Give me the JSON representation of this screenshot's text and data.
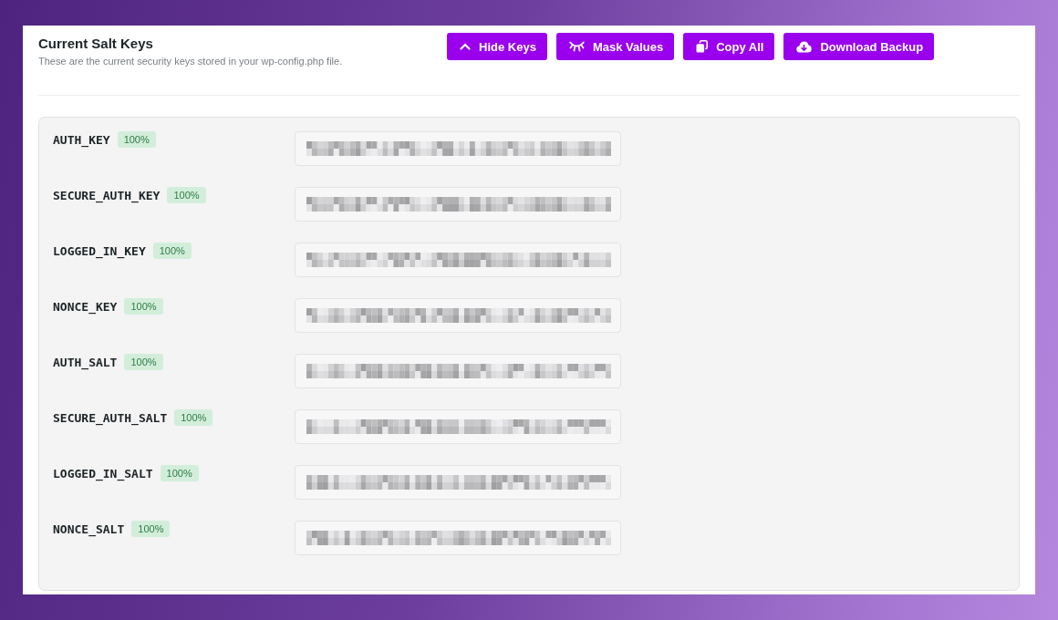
{
  "header": {
    "title": "Current Salt Keys",
    "subtitle": "These are the current security keys stored in your wp-config.php file."
  },
  "actions": [
    {
      "kind": "chevron-up",
      "label": "Hide Keys"
    },
    {
      "kind": "closed-eye",
      "label": "Mask Values"
    },
    {
      "kind": "copy",
      "label": "Copy All"
    },
    {
      "kind": "cloud-download",
      "label": "Download Backup"
    }
  ],
  "keys": [
    {
      "name": "AUTH_KEY",
      "strength": "100%"
    },
    {
      "name": "SECURE_AUTH_KEY",
      "strength": "100%"
    },
    {
      "name": "LOGGED_IN_KEY",
      "strength": "100%"
    },
    {
      "name": "NONCE_KEY",
      "strength": "100%"
    },
    {
      "name": "AUTH_SALT",
      "strength": "100%"
    },
    {
      "name": "SECURE_AUTH_SALT",
      "strength": "100%"
    },
    {
      "name": "LOGGED_IN_SALT",
      "strength": "100%"
    },
    {
      "name": "NONCE_SALT",
      "strength": "100%"
    }
  ]
}
